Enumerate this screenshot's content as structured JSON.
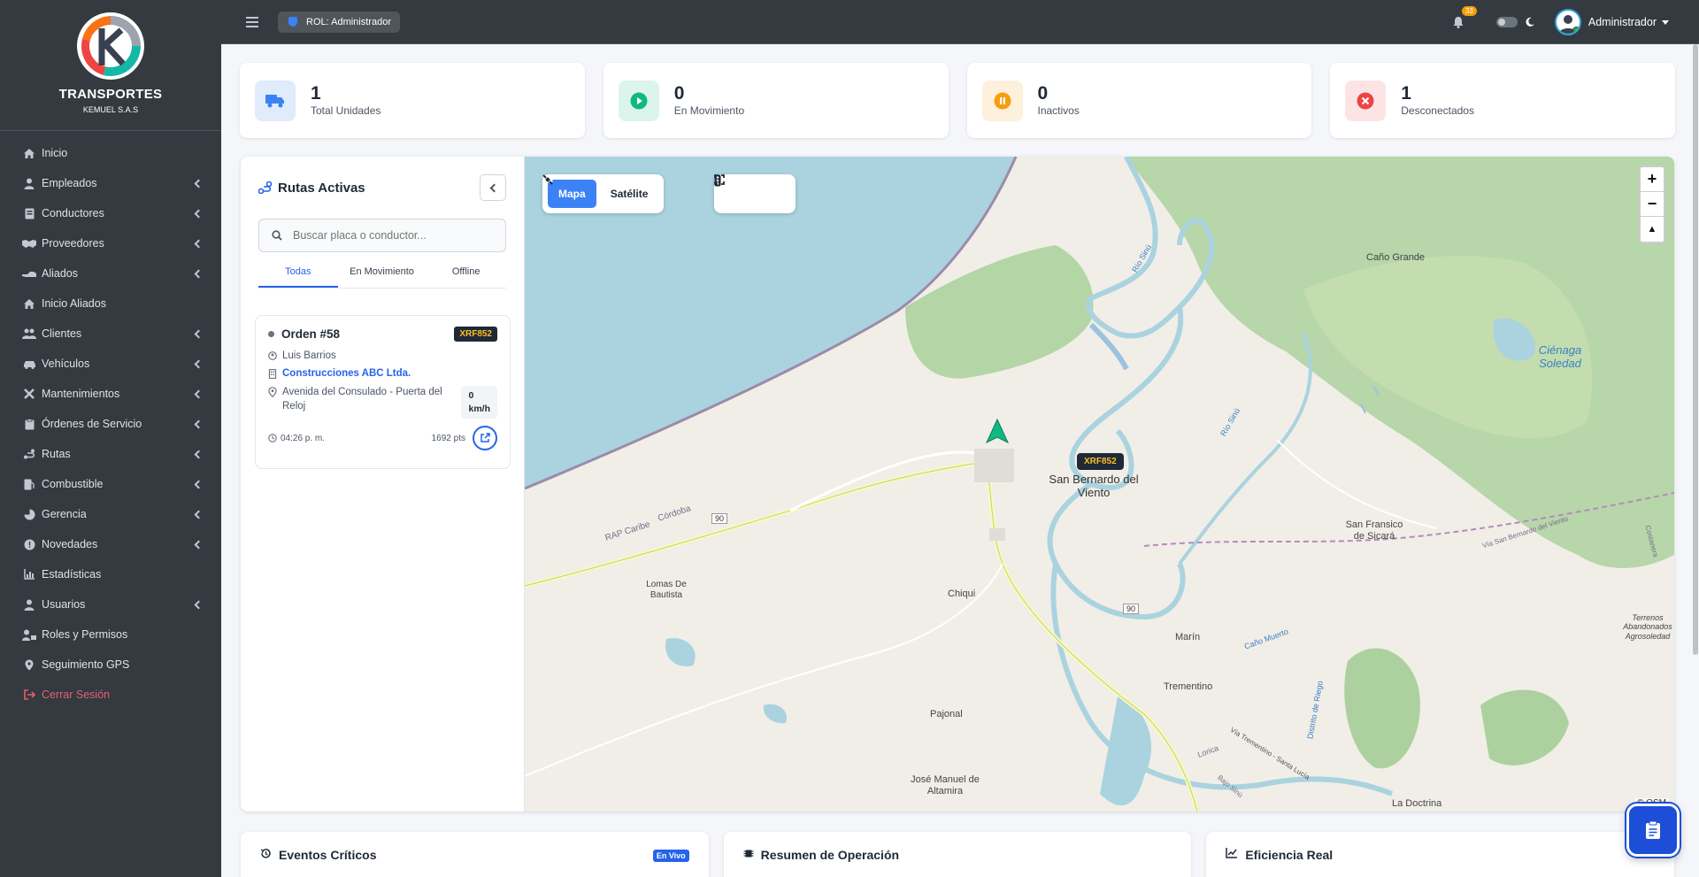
{
  "brand": {
    "title": "TRANSPORTES",
    "subtitle": "KEMUEL S.A.S"
  },
  "sidebar": {
    "items": [
      {
        "label": "Inicio",
        "icon": "home-icon",
        "chevron": false
      },
      {
        "label": "Empleados",
        "icon": "user-icon",
        "chevron": true
      },
      {
        "label": "Conductores",
        "icon": "id-card-icon",
        "chevron": true
      },
      {
        "label": "Proveedores",
        "icon": "handshake-icon",
        "chevron": true
      },
      {
        "label": "Aliados",
        "icon": "hand-icon",
        "chevron": true
      },
      {
        "label": "Inicio Aliados",
        "icon": "home-icon",
        "chevron": false
      },
      {
        "label": "Clientes",
        "icon": "users-icon",
        "chevron": true
      },
      {
        "label": "Vehículos",
        "icon": "car-icon",
        "chevron": true
      },
      {
        "label": "Mantenimientos",
        "icon": "tools-icon",
        "chevron": true
      },
      {
        "label": "Órdenes de Servicio",
        "icon": "clipboard-icon",
        "chevron": true
      },
      {
        "label": "Rutas",
        "icon": "route-icon",
        "chevron": true
      },
      {
        "label": "Combustible",
        "icon": "fuel-icon",
        "chevron": true
      },
      {
        "label": "Gerencia",
        "icon": "chart-pie-icon",
        "chevron": true
      },
      {
        "label": "Novedades",
        "icon": "alert-icon",
        "chevron": true
      },
      {
        "label": "Estadísticas",
        "icon": "chart-line-icon",
        "chevron": false
      },
      {
        "label": "Usuarios",
        "icon": "user-icon",
        "chevron": true
      },
      {
        "label": "Roles y Permisos",
        "icon": "user-lock-icon",
        "chevron": false
      },
      {
        "label": "Seguimiento GPS",
        "icon": "map-pin-icon",
        "chevron": false
      }
    ],
    "logout_label": "Cerrar Sesión"
  },
  "topbar": {
    "role": "ROL: Administrador",
    "notifications_count": "33",
    "user_name": "Administrador"
  },
  "stats": [
    {
      "value": "1",
      "label": "Total Unidades",
      "icon": "truck-icon",
      "color": "#3b82f6",
      "bg": "#e0ebfc"
    },
    {
      "value": "0",
      "label": "En Movimiento",
      "icon": "play-icon",
      "color": "#10b981",
      "bg": "#dcf5ec"
    },
    {
      "value": "0",
      "label": "Inactivos",
      "icon": "pause-icon",
      "color": "#f59e0b",
      "bg": "#fdf0dc"
    },
    {
      "value": "1",
      "label": "Desconectados",
      "icon": "x-circle-icon",
      "color": "#ef4444",
      "bg": "#fde4e4"
    }
  ],
  "routes": {
    "title": "Rutas Activas",
    "search_placeholder": "Buscar placa o conductor...",
    "tabs": [
      "Todas",
      "En Movimiento",
      "Offline"
    ],
    "card": {
      "order": "Orden #58",
      "plate": "XRF852",
      "driver": "Luis Barrios",
      "client": "Construcciones ABC Ltda.",
      "address": "Avenida del Consulado - Puerta del Reloj",
      "speed_value": "0",
      "speed_unit": "km/h",
      "time": "04:26 p. m.",
      "points": "1692 pts"
    }
  },
  "map": {
    "mode_map": "Mapa",
    "mode_satellite": "Satélite",
    "vehicle_plate": "XRF852",
    "attribution": "© OSM",
    "labels": {
      "sanbernardo": "San Bernardo del Viento",
      "canogrande": "Caño Grande",
      "cienaga": "Ciénaga Soledad",
      "sanfrancisco": "San Fransico de Sicará",
      "chiqui": "Chiqui",
      "marin": "Marín",
      "trementino": "Trementino",
      "pajonal": "Pajonal",
      "josemanuel": "José Manuel de Altamira",
      "ladoctrina": "La Doctrina",
      "lomas": "Lomas De Bautista",
      "terrenos": "Terrenos Abandonados Agrosoledad",
      "rapcaribe": "RAP Caribe",
      "cordoba": "Córdoba",
      "riosinu1": "Río Sinú",
      "riosinu2": "Río Sinú",
      "canomuerto": "Caño Muerto",
      "distrito": "Distrito de Riego",
      "vsbv": "Vía San Bernardo del Viento",
      "vtsl": "Vía Trementino - Santa Lucía",
      "lorica": "Lorica",
      "bajosinu": "Bajo Sinú",
      "costanera": "Costanera",
      "r90a": "90",
      "r90b": "90"
    }
  },
  "bottom": {
    "events": "Eventos Críticos",
    "live": "En Vivo",
    "summary": "Resumen de Operación",
    "efficiency": "Eficiencia Real"
  }
}
